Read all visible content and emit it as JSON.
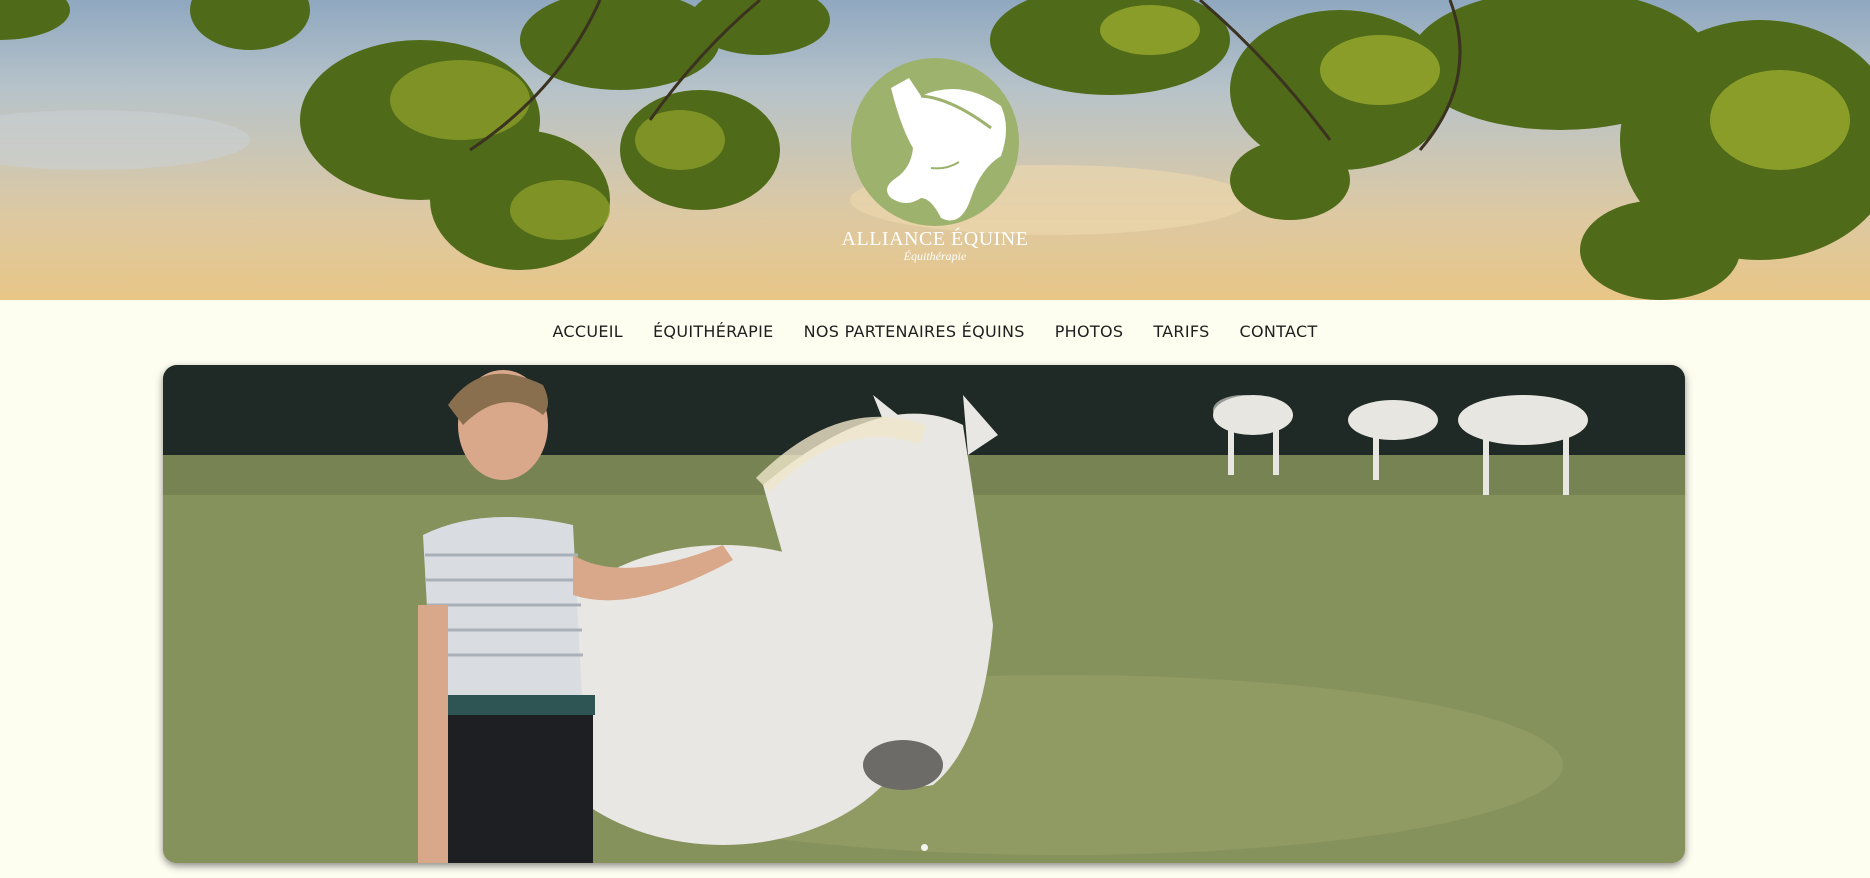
{
  "brand": {
    "name": "ALLIANCE ÉQUINE",
    "tagline": "Équithérapie",
    "logo_color": "#9db26d"
  },
  "nav": {
    "items": [
      {
        "label": "ACCUEIL"
      },
      {
        "label": "ÉQUITHÉRAPIE"
      },
      {
        "label": "NOS PARTENAIRES ÉQUINS"
      },
      {
        "label": "PHOTOS"
      },
      {
        "label": "TARIFS"
      },
      {
        "label": "CONTACT"
      }
    ]
  },
  "slideshow": {
    "image": "woman-with-white-horse-in-field",
    "slide_count": 1,
    "active_slide": 1
  },
  "colors": {
    "page_background": "#fdfdf0",
    "nav_text": "#1f1f1f"
  }
}
